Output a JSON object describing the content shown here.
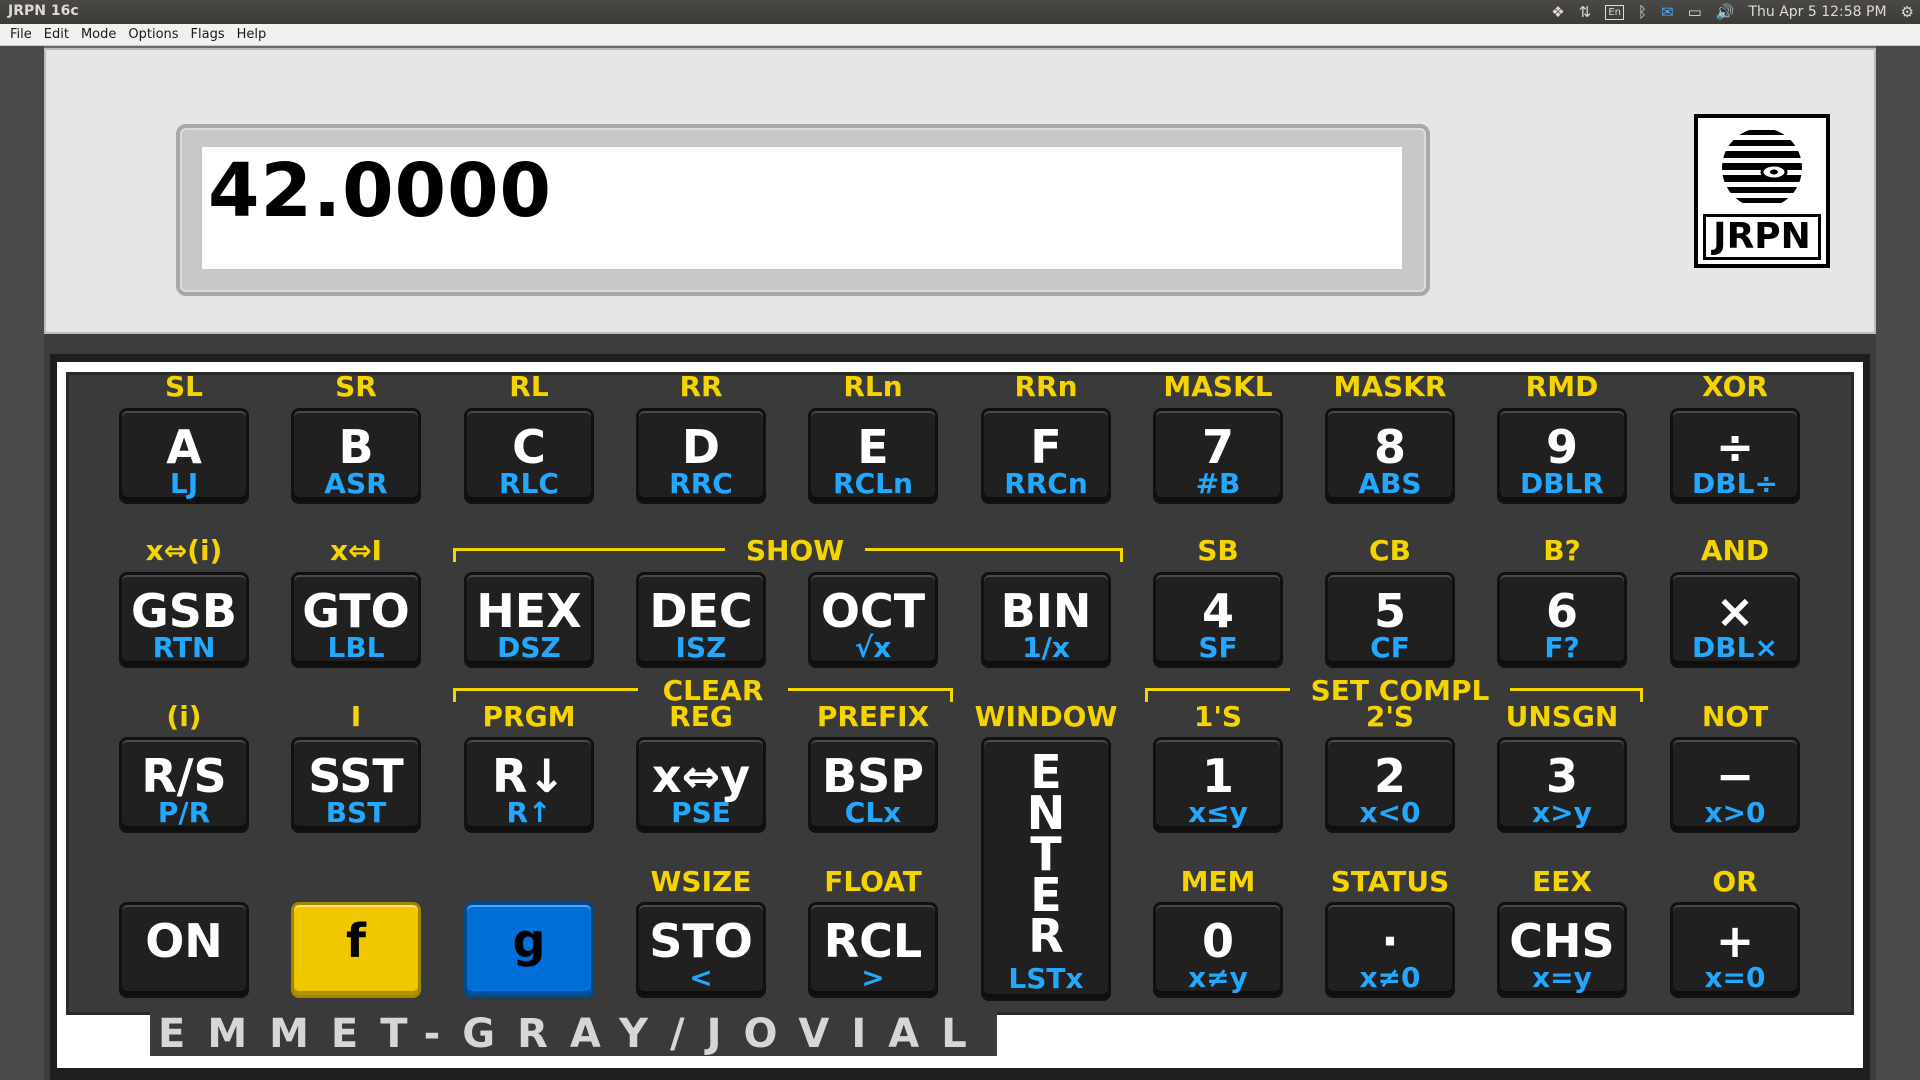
{
  "window": {
    "title": "JRPN 16c"
  },
  "tray": {
    "keyboard_layout": "En",
    "clock": "Thu Apr  5 12:58 PM"
  },
  "menu": [
    "File",
    "Edit",
    "Mode",
    "Options",
    "Flags",
    "Help"
  ],
  "display": {
    "value": "42.0000"
  },
  "logo": {
    "text": "JRPN"
  },
  "brand": "EMMET-GRAY/JOVIAL",
  "groups": {
    "show": "SHOW",
    "clear": "CLEAR",
    "set_compl": "SET COMPL"
  },
  "rows": [
    [
      {
        "f": "SL",
        "main": "A",
        "g": "LJ"
      },
      {
        "f": "SR",
        "main": "B",
        "g": "ASR"
      },
      {
        "f": "RL",
        "main": "C",
        "g": "RLC"
      },
      {
        "f": "RR",
        "main": "D",
        "g": "RRC"
      },
      {
        "f": "RLn",
        "main": "E",
        "g": "RCLn"
      },
      {
        "f": "RRn",
        "main": "F",
        "g": "RRCn"
      },
      {
        "f": "MASKL",
        "main": "7",
        "g": "#B"
      },
      {
        "f": "MASKR",
        "main": "8",
        "g": "ABS"
      },
      {
        "f": "RMD",
        "main": "9",
        "g": "DBLR"
      },
      {
        "f": "XOR",
        "main": "÷",
        "g": "DBL÷"
      }
    ],
    [
      {
        "f": "x⇔(i)",
        "main": "GSB",
        "g": "RTN"
      },
      {
        "f": "x⇔I",
        "main": "GTO",
        "g": "LBL"
      },
      {
        "f": "",
        "main": "HEX",
        "g": "DSZ"
      },
      {
        "f": "",
        "main": "DEC",
        "g": "ISZ"
      },
      {
        "f": "",
        "main": "OCT",
        "g": "√x"
      },
      {
        "f": "",
        "main": "BIN",
        "g": "1/x"
      },
      {
        "f": "SB",
        "main": "4",
        "g": "SF"
      },
      {
        "f": "CB",
        "main": "5",
        "g": "CF"
      },
      {
        "f": "B?",
        "main": "6",
        "g": "F?"
      },
      {
        "f": "AND",
        "main": "×",
        "g": "DBL×"
      }
    ],
    [
      {
        "f": "(i)",
        "main": "R/S",
        "g": "P/R"
      },
      {
        "f": "I",
        "main": "SST",
        "g": "BST"
      },
      {
        "f": "PRGM",
        "main": "R↓",
        "g": "R↑"
      },
      {
        "f": "REG",
        "main": "x⇔y",
        "g": "PSE"
      },
      {
        "f": "PREFIX",
        "main": "BSP",
        "g": "CLx"
      },
      {
        "f": "WINDOW",
        "main": "E\nN\nT\nE\nR",
        "g": "LSTx"
      },
      {
        "f": "1'S",
        "main": "1",
        "g": "x≤y"
      },
      {
        "f": "2'S",
        "main": "2",
        "g": "x<0"
      },
      {
        "f": "UNSGN",
        "main": "3",
        "g": "x>y"
      },
      {
        "f": "NOT",
        "main": "−",
        "g": "x>0"
      }
    ],
    [
      {
        "f": "",
        "main": "ON",
        "g": ""
      },
      {
        "f": "",
        "main": "f",
        "g": ""
      },
      {
        "f": "",
        "main": "g",
        "g": ""
      },
      {
        "f": "WSIZE",
        "main": "STO",
        "g": "<"
      },
      {
        "f": "FLOAT",
        "main": "RCL",
        "g": ">"
      },
      {
        "f": "",
        "main": "",
        "g": ""
      },
      {
        "f": "MEM",
        "main": "0",
        "g": "x≠y"
      },
      {
        "f": "STATUS",
        "main": "·",
        "g": "x≠0"
      },
      {
        "f": "EEX",
        "main": "CHS",
        "g": "x=y"
      },
      {
        "f": "OR",
        "main": "+",
        "g": "x=0"
      }
    ]
  ]
}
